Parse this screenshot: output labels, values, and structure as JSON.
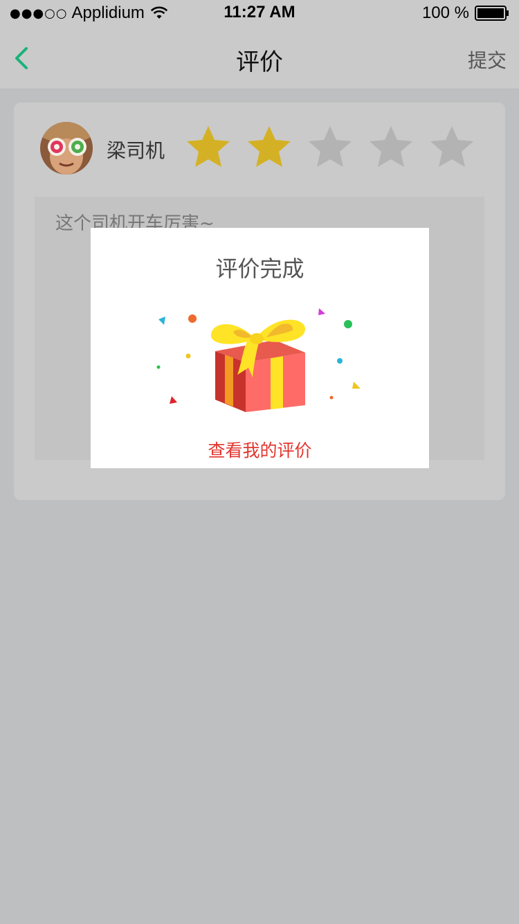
{
  "status_bar": {
    "signal": "●●●○○",
    "carrier": "Applidium",
    "time": "11:27 AM",
    "battery": "100 %"
  },
  "nav": {
    "title": "评价",
    "submit_label": "提交",
    "back_icon": "chevron-left-icon",
    "back_color": "#19b27b"
  },
  "review": {
    "driver_name": "梁司机",
    "rating": 2,
    "max_rating": 5,
    "star_filled_color": "#d4b124",
    "star_empty_color": "#b3b3b3",
    "comment": "这个司机开车厉害~"
  },
  "modal": {
    "title": "评价完成",
    "link_label": "查看我的评价",
    "link_color": "#e2352e",
    "illustration": "gift-box-icon"
  }
}
